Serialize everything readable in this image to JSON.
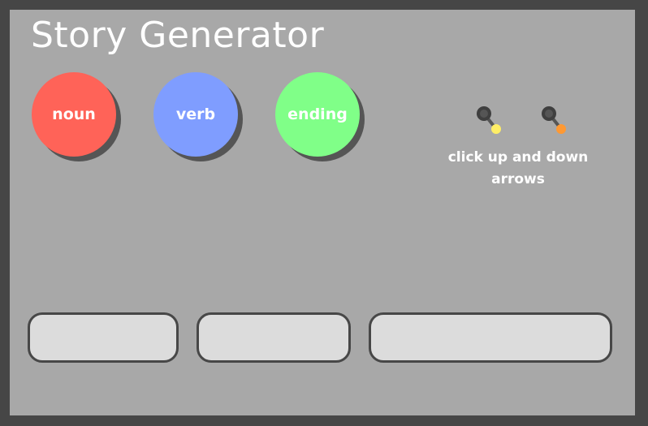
{
  "app": {
    "title": "Story Generator"
  },
  "buttons": {
    "noun_label": "noun",
    "verb_label": "verb",
    "ending_label": "ending"
  },
  "controls": {
    "hint_text": "click up and down arrows",
    "lever_icons": [
      "lever-toggle-icon",
      "lever-toggle-icon"
    ],
    "lever_knob_colors": [
      "#ffee66",
      "#ff9933"
    ]
  },
  "outputs": {
    "noun_value": "",
    "verb_value": "",
    "ending_value": ""
  },
  "colors": {
    "background_outer": "#464646",
    "background_inner": "#a8a8a8",
    "noun": "#ff6358",
    "verb": "#7f9dff",
    "ending": "#80ff88",
    "slot_fill": "#dcdcdc",
    "slot_border": "#474747"
  }
}
